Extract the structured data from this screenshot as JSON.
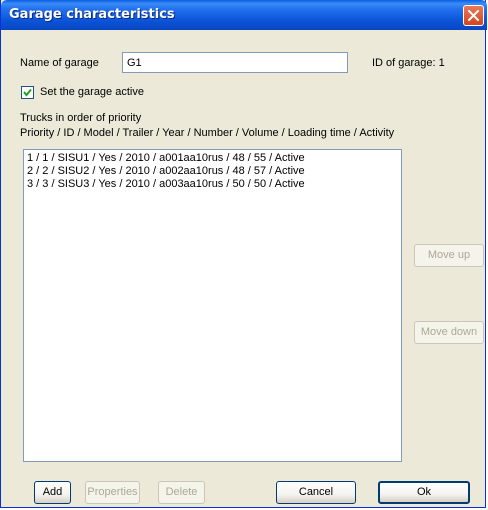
{
  "window": {
    "title": "Garage characteristics"
  },
  "garage": {
    "name_label": "Name of garage",
    "name_value": "G1",
    "id_text": "ID of garage: 1",
    "active_label": "Set the garage active",
    "active_checked": true
  },
  "trucks": {
    "heading": "Trucks in order of priority",
    "columns": "Priority / ID / Model / Trailer / Year / Number / Volume / Loading time / Activity",
    "items": [
      "1 / 1 / SISU1 / Yes / 2010 / a001aa10rus / 48 / 55 / Active",
      "2 / 2 / SISU2 / Yes / 2010 / a002aa10rus / 48 / 57 / Active",
      "3 / 3 / SISU3 / Yes / 2010 / a003aa10rus / 50 / 50 / Active"
    ]
  },
  "buttons": {
    "move_up": "Move up",
    "move_down": "Move down",
    "add": "Add",
    "properties": "Properties",
    "delete": "Delete",
    "cancel": "Cancel",
    "ok": "Ok"
  },
  "icons": {
    "close": "close-icon",
    "check": "checkmark-icon"
  },
  "colors": {
    "titlebar": "#0b53d8",
    "close_button": "#d2451f",
    "dialog_background": "#ece9d8",
    "disabled_text": "#aca899"
  }
}
